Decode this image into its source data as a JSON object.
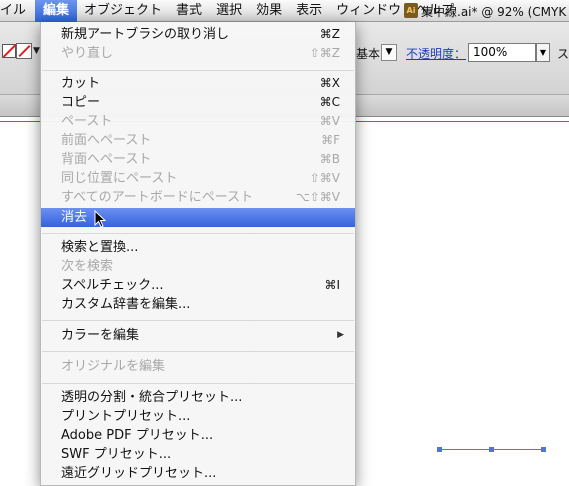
{
  "menubar": {
    "items": [
      {
        "label": "イル",
        "active": false
      },
      {
        "label": "編集",
        "active": true
      },
      {
        "label": "オブジェクト",
        "active": false
      },
      {
        "label": "書式",
        "active": false
      },
      {
        "label": "選択",
        "active": false
      },
      {
        "label": "効果",
        "active": false
      },
      {
        "label": "表示",
        "active": false
      },
      {
        "label": "ウィンドウ",
        "active": false
      },
      {
        "label": "ヘルプ",
        "active": false
      }
    ]
  },
  "control_bar": {
    "style_label": "基本",
    "opacity_label": "不透明度：",
    "opacity_value": "100%",
    "more_label": "ス"
  },
  "document_tab": {
    "icon_text": "Ai",
    "title": "集中線.ai* @ 92% (CMYK"
  },
  "edit_menu": {
    "items": [
      {
        "label": "新規アートブラシの取り消し",
        "shortcut": "⌘Z",
        "enabled": true
      },
      {
        "label": "やり直し",
        "shortcut": "⇧⌘Z",
        "enabled": false
      },
      {
        "label": "カット",
        "shortcut": "⌘X",
        "enabled": true
      },
      {
        "label": "コピー",
        "shortcut": "⌘C",
        "enabled": true
      },
      {
        "label": "ペースト",
        "shortcut": "⌘V",
        "enabled": false
      },
      {
        "label": "前面へペースト",
        "shortcut": "⌘F",
        "enabled": false
      },
      {
        "label": "背面へペースト",
        "shortcut": "⌘B",
        "enabled": false
      },
      {
        "label": "同じ位置にペースト",
        "shortcut": "⇧⌘V",
        "enabled": false
      },
      {
        "label": "すべてのアートボードにペースト",
        "shortcut": "⌥⇧⌘V",
        "enabled": false
      },
      {
        "label": "消去",
        "shortcut": "",
        "enabled": true,
        "highlighted": true
      },
      {
        "label": "検索と置換...",
        "shortcut": "",
        "enabled": true
      },
      {
        "label": "次を検索",
        "shortcut": "",
        "enabled": false
      },
      {
        "label": "スペルチェック...",
        "shortcut": "⌘I",
        "enabled": true
      },
      {
        "label": "カスタム辞書を編集...",
        "shortcut": "",
        "enabled": true
      },
      {
        "label": "カラーを編集",
        "shortcut": "",
        "enabled": true,
        "submenu": true
      },
      {
        "label": "オリジナルを編集",
        "shortcut": "",
        "enabled": false
      },
      {
        "label": "透明の分割・統合プリセット...",
        "shortcut": "",
        "enabled": true
      },
      {
        "label": "プリントプリセット...",
        "shortcut": "",
        "enabled": true
      },
      {
        "label": "Adobe PDF プリセット...",
        "shortcut": "",
        "enabled": true
      },
      {
        "label": "SWF プリセット...",
        "shortcut": "",
        "enabled": true
      },
      {
        "label": "遠近グリッドプリセット...",
        "shortcut": "",
        "enabled": true
      }
    ]
  },
  "colors": {
    "highlight": "#3463de",
    "disabled_text": "#a8a8a8",
    "artboard_edge": "#e23b3b",
    "selection": "#4a78d4"
  },
  "icons": {
    "submenu": "triangle-right-icon",
    "cursor": "arrow-pointer-icon"
  }
}
